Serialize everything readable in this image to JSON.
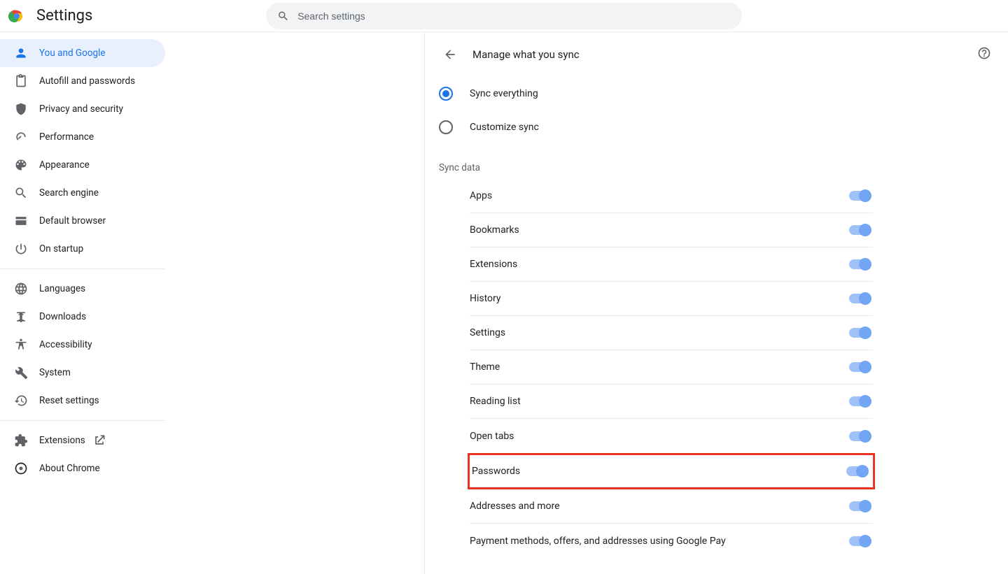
{
  "header": {
    "title": "Settings",
    "search_placeholder": "Search settings"
  },
  "sidebar": {
    "groups": [
      [
        {
          "id": "you-and-google",
          "label": "You and Google",
          "active": true,
          "icon": "person"
        },
        {
          "id": "autofill",
          "label": "Autofill and passwords",
          "icon": "clipboard"
        },
        {
          "id": "privacy",
          "label": "Privacy and security",
          "icon": "shield"
        },
        {
          "id": "performance",
          "label": "Performance",
          "icon": "speedometer"
        },
        {
          "id": "appearance",
          "label": "Appearance",
          "icon": "palette"
        },
        {
          "id": "search-engine",
          "label": "Search engine",
          "icon": "search"
        },
        {
          "id": "default-browser",
          "label": "Default browser",
          "icon": "browser"
        },
        {
          "id": "on-startup",
          "label": "On startup",
          "icon": "power"
        }
      ],
      [
        {
          "id": "languages",
          "label": "Languages",
          "icon": "globe"
        },
        {
          "id": "downloads",
          "label": "Downloads",
          "icon": "download"
        },
        {
          "id": "accessibility",
          "label": "Accessibility",
          "icon": "accessibility"
        },
        {
          "id": "system",
          "label": "System",
          "icon": "wrench"
        },
        {
          "id": "reset",
          "label": "Reset settings",
          "icon": "restore"
        }
      ],
      [
        {
          "id": "extensions",
          "label": "Extensions",
          "icon": "extension",
          "external": true
        },
        {
          "id": "about",
          "label": "About Chrome",
          "icon": "chrome"
        }
      ]
    ]
  },
  "main": {
    "title": "Manage what you sync",
    "radio_options": {
      "sync_everything": "Sync everything",
      "customize_sync": "Customize sync",
      "selected": "sync_everything"
    },
    "section_label": "Sync data",
    "toggles": [
      {
        "id": "apps",
        "label": "Apps",
        "on": true
      },
      {
        "id": "bookmarks",
        "label": "Bookmarks",
        "on": true
      },
      {
        "id": "extensions",
        "label": "Extensions",
        "on": true
      },
      {
        "id": "history",
        "label": "History",
        "on": true
      },
      {
        "id": "settings",
        "label": "Settings",
        "on": true
      },
      {
        "id": "theme",
        "label": "Theme",
        "on": true
      },
      {
        "id": "reading-list",
        "label": "Reading list",
        "on": true
      },
      {
        "id": "open-tabs",
        "label": "Open tabs",
        "on": true
      },
      {
        "id": "passwords",
        "label": "Passwords",
        "on": true,
        "highlight": true
      },
      {
        "id": "addresses",
        "label": "Addresses and more",
        "on": true
      },
      {
        "id": "payment",
        "label": "Payment methods, offers, and addresses using Google Pay",
        "on": true
      }
    ]
  }
}
